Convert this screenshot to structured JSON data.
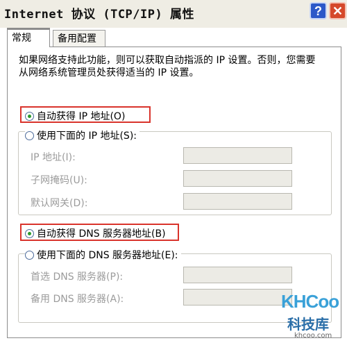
{
  "window": {
    "title": "Internet 协议 (TCP/IP) 属性",
    "help_label": "?",
    "close_label": "✕"
  },
  "tabs": [
    {
      "label": "常规",
      "active": true
    },
    {
      "label": "备用配置",
      "active": false
    }
  ],
  "description": "如果网络支持此功能，则可以获取自动指派的 IP 设置。否则，您需要从网络系统管理员处获得适当的 IP 设置。",
  "ip_section": {
    "auto_label": "自动获得 IP 地址(O)",
    "auto_checked": true,
    "manual_label": "使用下面的 IP 地址(S):",
    "fields": [
      {
        "label": "IP 地址(I):",
        "value": ""
      },
      {
        "label": "子网掩码(U):",
        "value": ""
      },
      {
        "label": "默认网关(D):",
        "value": ""
      }
    ]
  },
  "dns_section": {
    "auto_label": "自动获得 DNS 服务器地址(B)",
    "auto_checked": true,
    "manual_label": "使用下面的 DNS 服务器地址(E):",
    "fields": [
      {
        "label": "首选 DNS 服务器(P):",
        "value": ""
      },
      {
        "label": "备用 DNS 服务器(A):",
        "value": ""
      }
    ]
  },
  "watermark": {
    "brand": "KHCoo",
    "name_cn": "科技库",
    "url": "khcoo.com"
  },
  "colors": {
    "highlight_border": "#d9332b",
    "tab_accent": "#f2a93b",
    "radio_dot": "#2b9a2b"
  }
}
